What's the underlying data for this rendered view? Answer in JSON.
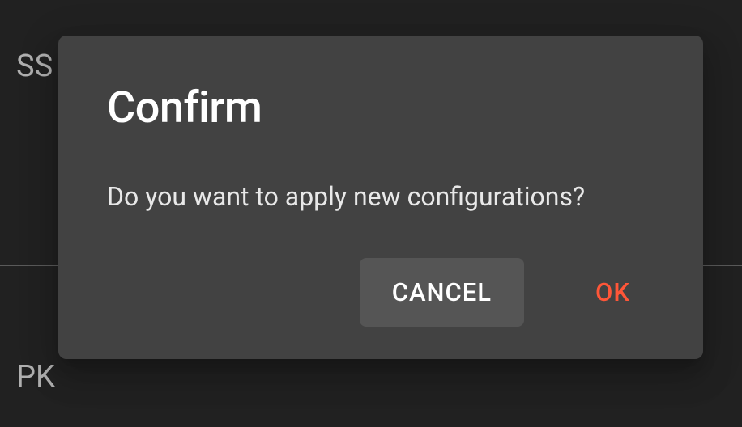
{
  "background": {
    "label_1": "SS",
    "label_2": "PK"
  },
  "dialog": {
    "title": "Confirm",
    "message": "Do you want to apply new configurations?",
    "actions": {
      "cancel_label": "CANCEL",
      "ok_label": "OK"
    }
  }
}
